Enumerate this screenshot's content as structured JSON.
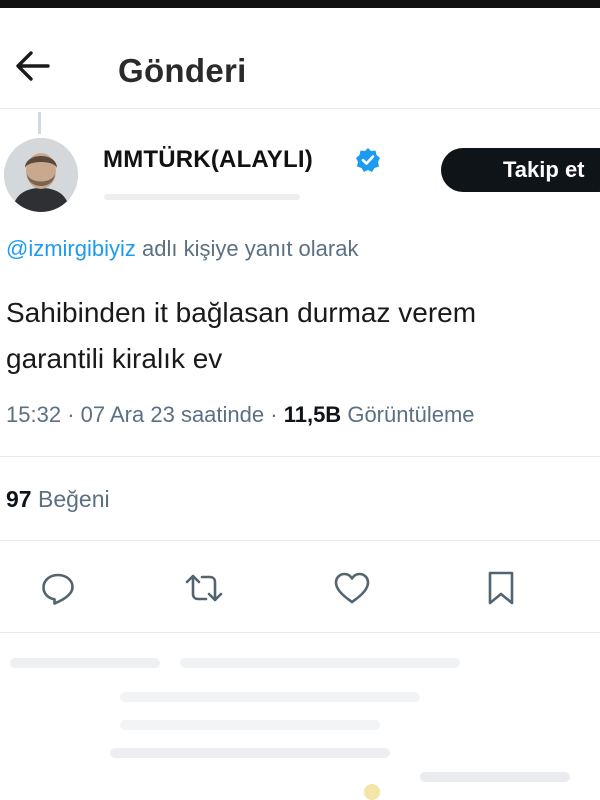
{
  "header": {
    "title": "Gönderi",
    "back_icon": "arrow-left-icon"
  },
  "author": {
    "name": "MMTÜRK(ALAYLI)",
    "verified": true,
    "verified_color": "#1d9bf0",
    "avatar_icon": "avatar"
  },
  "follow_button": {
    "label": "Takip et"
  },
  "reply_context": {
    "mention": "@izmirgibiyiz",
    "suffix": "adlı kişiye yanıt olarak"
  },
  "tweet": {
    "line1": "Sahibinden it bağlasan durmaz verem",
    "line2": "garantili kiralık ev"
  },
  "meta": {
    "time": "15:32",
    "sep1": "·",
    "date": "07 Ara 23 saatinde",
    "sep2": "·",
    "views_count": "11,5B",
    "views_label": "Görüntüleme"
  },
  "stats": {
    "likes_count": "97",
    "likes_label": "Beğeni"
  },
  "actions": [
    {
      "icon": "reply-icon"
    },
    {
      "icon": "retweet-icon"
    },
    {
      "icon": "like-icon"
    },
    {
      "icon": "bookmark-icon"
    }
  ],
  "colors": {
    "link": "#1d9bf0",
    "muted": "#5b7083",
    "text": "#0f1419",
    "button": "#0f1419"
  }
}
